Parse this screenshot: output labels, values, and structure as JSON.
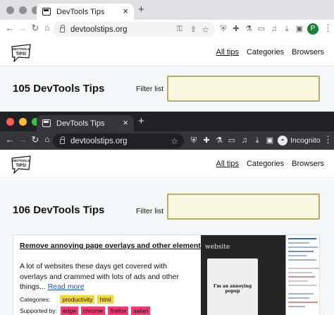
{
  "windows": [
    {
      "id": "back",
      "tab": {
        "title": "DevTools Tips",
        "close": "×"
      },
      "new_tab": "+",
      "url": "devtoolstips.org",
      "profile_initial": "P",
      "site": {
        "nav": [
          {
            "label": "All tips",
            "active": true
          },
          {
            "label": "Categories"
          },
          {
            "label": "Browsers"
          }
        ],
        "count_heading": "105 DevTools Tips",
        "filter_label": "Filter list"
      }
    },
    {
      "id": "front",
      "tab": {
        "title": "DevTools Tips",
        "close": "×"
      },
      "new_tab": "+",
      "url": "devtoolstips.org",
      "incognito_label": "Incognito",
      "site": {
        "nav": [
          {
            "label": "All tips",
            "active": true
          },
          {
            "label": "Categories"
          },
          {
            "label": "Browsers"
          }
        ],
        "count_heading": "106 DevTools Tips",
        "filter_label": "Filter list",
        "tip": {
          "title": "Remove annoying page overlays and other elements",
          "description": "A lot of websites these days get covered with overlays and crammed with lots of ads and other things...",
          "read_more": "Read more",
          "categories_label": "Categories:",
          "categories": [
            "productivity",
            "html"
          ],
          "supported_label": "Supported by:",
          "browsers": [
            "edge",
            "chrome",
            "firefox",
            "safari"
          ],
          "screenshot": {
            "website_text": "website",
            "popup_text": "I'm an annoying popup"
          }
        }
      }
    }
  ],
  "logo_text": [
    "DEVTOOLS",
    "TIPS!"
  ],
  "colors": {
    "light_chrome_frame": "#dfe1e5",
    "dark_chrome_frame": "#202124",
    "dark_chrome_toolbar": "#35363a",
    "hero_bg": "#f3f7fa",
    "filter_bg": "#f8f6df",
    "tag_yellow": "#f4d83a",
    "tag_pink": "#ec3d74",
    "link": "#1a4fc4"
  }
}
